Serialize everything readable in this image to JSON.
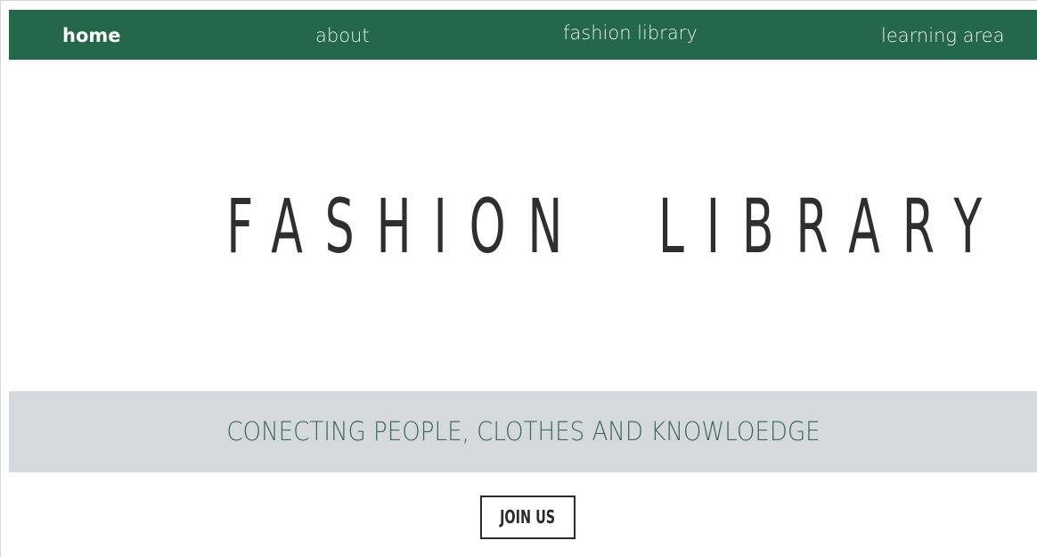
{
  "nav": {
    "items": [
      {
        "label": "home",
        "active": true
      },
      {
        "label": "about",
        "active": false
      },
      {
        "label": "fashion library",
        "active": false
      },
      {
        "label": "learning area",
        "active": false
      }
    ]
  },
  "hero": {
    "title": "FASHION  LIBRARY"
  },
  "tagline": {
    "text": "CONECTING PEOPLE, CLOTHES AND KNOWLOEDGE"
  },
  "cta": {
    "label": "JOIN US"
  },
  "colors": {
    "nav_background": "#25674a",
    "nav_text": "#ffffff",
    "hero_text": "#2f2f2f",
    "band_background": "#d5d8dc",
    "tagline_text": "#3b6d58",
    "button_border": "#2b2b2b"
  }
}
